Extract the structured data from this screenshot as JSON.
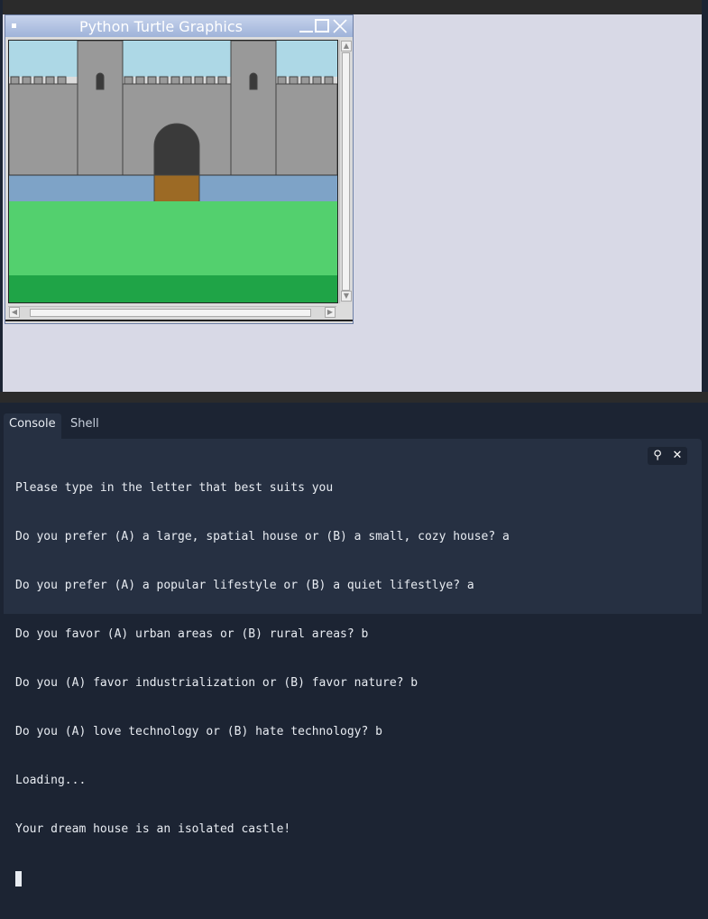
{
  "turtle_window": {
    "title": "Python Turtle Graphics",
    "icons": [
      "system-menu-icon",
      "minimize-icon",
      "maximize-icon",
      "close-icon"
    ]
  },
  "scene_colors": {
    "sky": "#add8e6",
    "wall": "#999999",
    "wall_outline": "#444444",
    "door": "#3a3a3a",
    "drawbridge": "#9c6a25",
    "moat": "#7ea3c7",
    "grass": "#53d06e",
    "dark_grass": "#1fa447"
  },
  "console": {
    "tabs": [
      {
        "label": "Console",
        "active": true
      },
      {
        "label": "Shell",
        "active": false
      }
    ],
    "lines": [
      "Please type in the letter that best suits you",
      "Do you prefer (A) a large, spatial house or (B) a small, cozy house? a",
      "Do you prefer (A) a popular lifestyle or (B) a quiet lifestlye? a",
      "Do you favor (A) urban areas or (B) rural areas? b",
      "Do you (A) favor industrialization or (B) favor nature? b",
      "Do you (A) love technology or (B) hate technology? b",
      "Loading...",
      "Your dream house is an isolated castle!"
    ],
    "tools": [
      {
        "icon": "search-icon",
        "glyph": "⚲"
      },
      {
        "icon": "close-icon",
        "glyph": "✕"
      }
    ]
  }
}
